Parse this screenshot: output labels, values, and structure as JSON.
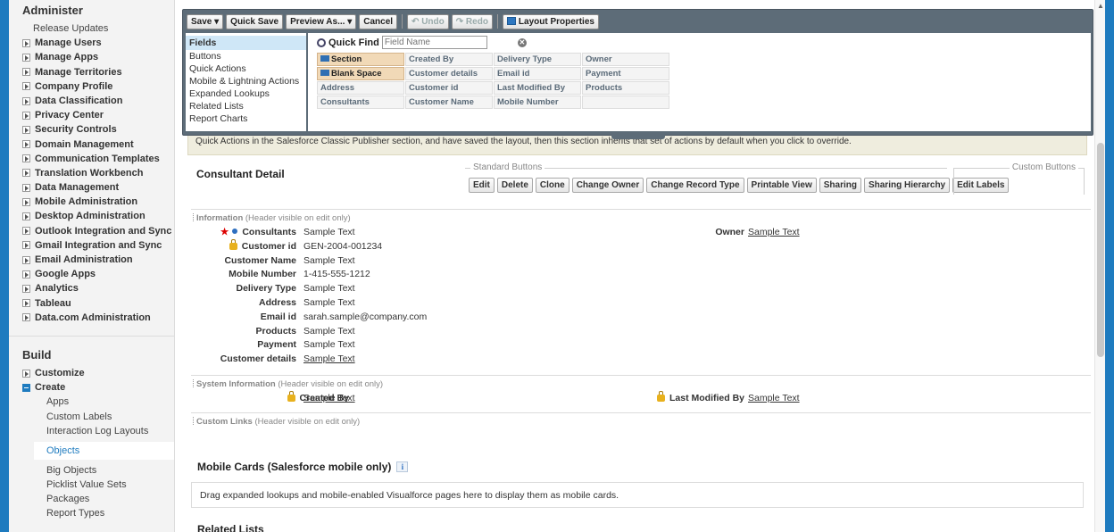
{
  "sidebar": {
    "administer_heading": "Administer",
    "release_updates": "Release Updates",
    "admin_items": [
      "Manage Users",
      "Manage Apps",
      "Manage Territories",
      "Company Profile",
      "Data Classification",
      "Privacy Center",
      "Security Controls",
      "Domain Management",
      "Communication Templates",
      "Translation Workbench",
      "Data Management",
      "Mobile Administration",
      "Desktop Administration",
      "Outlook Integration and Sync",
      "Gmail Integration and Sync",
      "Email Administration",
      "Google Apps",
      "Analytics",
      "Tableau",
      "Data.com Administration"
    ],
    "build_heading": "Build",
    "customize": "Customize",
    "create": "Create",
    "create_children": [
      "Apps",
      "Custom Labels",
      "Interaction Log Layouts"
    ],
    "selected": "Objects",
    "more_children": [
      "Big Objects",
      "Picklist Value Sets",
      "Packages",
      "Report Types"
    ]
  },
  "palette": {
    "toolbar": {
      "save": "Save",
      "quick_save": "Quick Save",
      "preview_as": "Preview As...",
      "cancel": "Cancel",
      "undo": "Undo",
      "redo": "Redo",
      "layout_properties": "Layout Properties"
    },
    "categories": [
      "Fields",
      "Buttons",
      "Quick Actions",
      "Mobile & Lightning Actions",
      "Expanded Lookups",
      "Related Lists",
      "Report Charts"
    ],
    "quick_find_label": "Quick Find",
    "quick_find_placeholder": "Field Name",
    "fields": [
      "Section",
      "Created By",
      "Delivery Type",
      "Owner",
      "Blank Space",
      "Customer details",
      "Email id",
      "Payment",
      "Address",
      "Customer id",
      "Last Modified By",
      "Products",
      "Consultants",
      "Customer Name",
      "Mobile Number",
      ""
    ]
  },
  "notice_text": "Quick Actions in the Salesforce Classic Publisher section, and have saved the layout, then this section inherits that set of actions by default when you click to override.",
  "detail": {
    "title": "Consultant Detail",
    "standard_buttons_label": "Standard Buttons",
    "custom_buttons_label": "Custom Buttons",
    "standard_buttons": [
      "Edit",
      "Delete",
      "Clone",
      "Change Owner",
      "Change Record Type",
      "Printable View",
      "Sharing",
      "Sharing Hierarchy",
      "Edit Labels"
    ]
  },
  "information": {
    "heading": "Information",
    "note": "(Header visible on edit only)",
    "fields": [
      {
        "label": "Consultants",
        "value": "Sample Text"
      },
      {
        "label": "Customer id",
        "value": "GEN-2004-001234"
      },
      {
        "label": "Customer Name",
        "value": "Sample Text"
      },
      {
        "label": "Mobile Number",
        "value": "1-415-555-1212"
      },
      {
        "label": "Delivery Type",
        "value": "Sample Text"
      },
      {
        "label": "Address",
        "value": "Sample Text"
      },
      {
        "label": "Email id",
        "value": "sarah.sample@company.com"
      },
      {
        "label": "Products",
        "value": "Sample Text"
      },
      {
        "label": "Payment",
        "value": "Sample Text"
      },
      {
        "label": "Customer details",
        "value": "Sample Text"
      }
    ],
    "owner_label": "Owner",
    "owner_value": "Sample Text"
  },
  "system_info": {
    "heading": "System Information",
    "note": "(Header visible on edit only)",
    "created_by_label": "Created By",
    "created_by_value": "Sample Text",
    "modified_by_label": "Last Modified By",
    "modified_by_value": "Sample Text"
  },
  "custom_links": {
    "heading": "Custom Links",
    "note": "(Header visible on edit only)"
  },
  "mobile_cards": {
    "title": "Mobile Cards (Salesforce mobile only)",
    "info_glyph": "i",
    "text": "Drag expanded lookups and mobile-enabled Visualforce pages here to display them as mobile cards."
  },
  "related_lists_title": "Related Lists",
  "colors": {
    "accent": "#1e7bbf",
    "palette_bg": "#5d6c78",
    "required": "#dd0000"
  }
}
